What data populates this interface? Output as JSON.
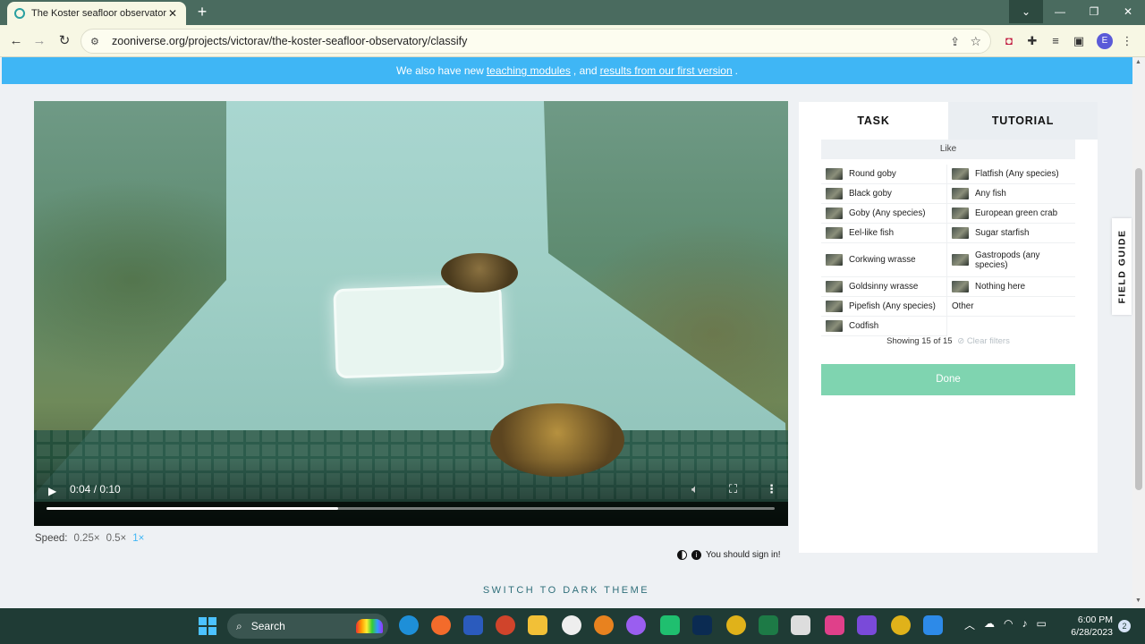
{
  "browser": {
    "tab_title": "The Koster seafloor observatory",
    "tab_close": "✕",
    "new_tab": "+",
    "url": "zooniverse.org/projects/victorav/the-koster-seafloor-observatory/classify",
    "profile_initial": "E",
    "icons": [
      "back-arrow-icon",
      "forward-arrow-icon",
      "reload-icon",
      "site-info-icon",
      "share-icon",
      "star-icon",
      "extension-icon",
      "puzzle-icon",
      "media-icon",
      "sidepanel-icon",
      "menu-icon"
    ]
  },
  "banner": {
    "text_before": "We also have new",
    "link1": "teaching modules",
    "text_mid": ", and",
    "link2": "results from our first version",
    "text_after": "."
  },
  "video": {
    "time": "0:04 / 0:10",
    "progress": 0.4
  },
  "speed": {
    "label": "Speed:",
    "options": [
      "0.25×",
      "0.5×",
      "1×"
    ],
    "selected": "1×"
  },
  "signin": {
    "text": "You should sign in!"
  },
  "theme_toggle": "SWITCH TO DARK THEME",
  "panel": {
    "tabs": [
      "TASK",
      "TUTORIAL"
    ],
    "active_tab": "TASK",
    "like_label": "Like",
    "choices": [
      "Round goby",
      "Flatfish (Any species)",
      "Black goby",
      "Any fish",
      "Goby (Any species)",
      "European green crab",
      "Eel-like fish",
      "Sugar starfish",
      "Corkwing wrasse",
      "Gastropods (any species)",
      "Goldsinny wrasse",
      "Nothing here",
      "Pipefish (Any species)",
      "Other",
      "Codfish"
    ],
    "showing": "Showing 15 of 15",
    "clear_filters": "Clear filters",
    "done": "Done"
  },
  "field_guide": "FIELD GUIDE",
  "taskbar": {
    "search": "Search",
    "time": "6:00 PM",
    "date": "6/28/2023",
    "notifications": "2"
  },
  "colors": {
    "banner": "#3fb6f5",
    "done_button": "#7fd4b0",
    "active_speed": "#3fb6f5"
  }
}
